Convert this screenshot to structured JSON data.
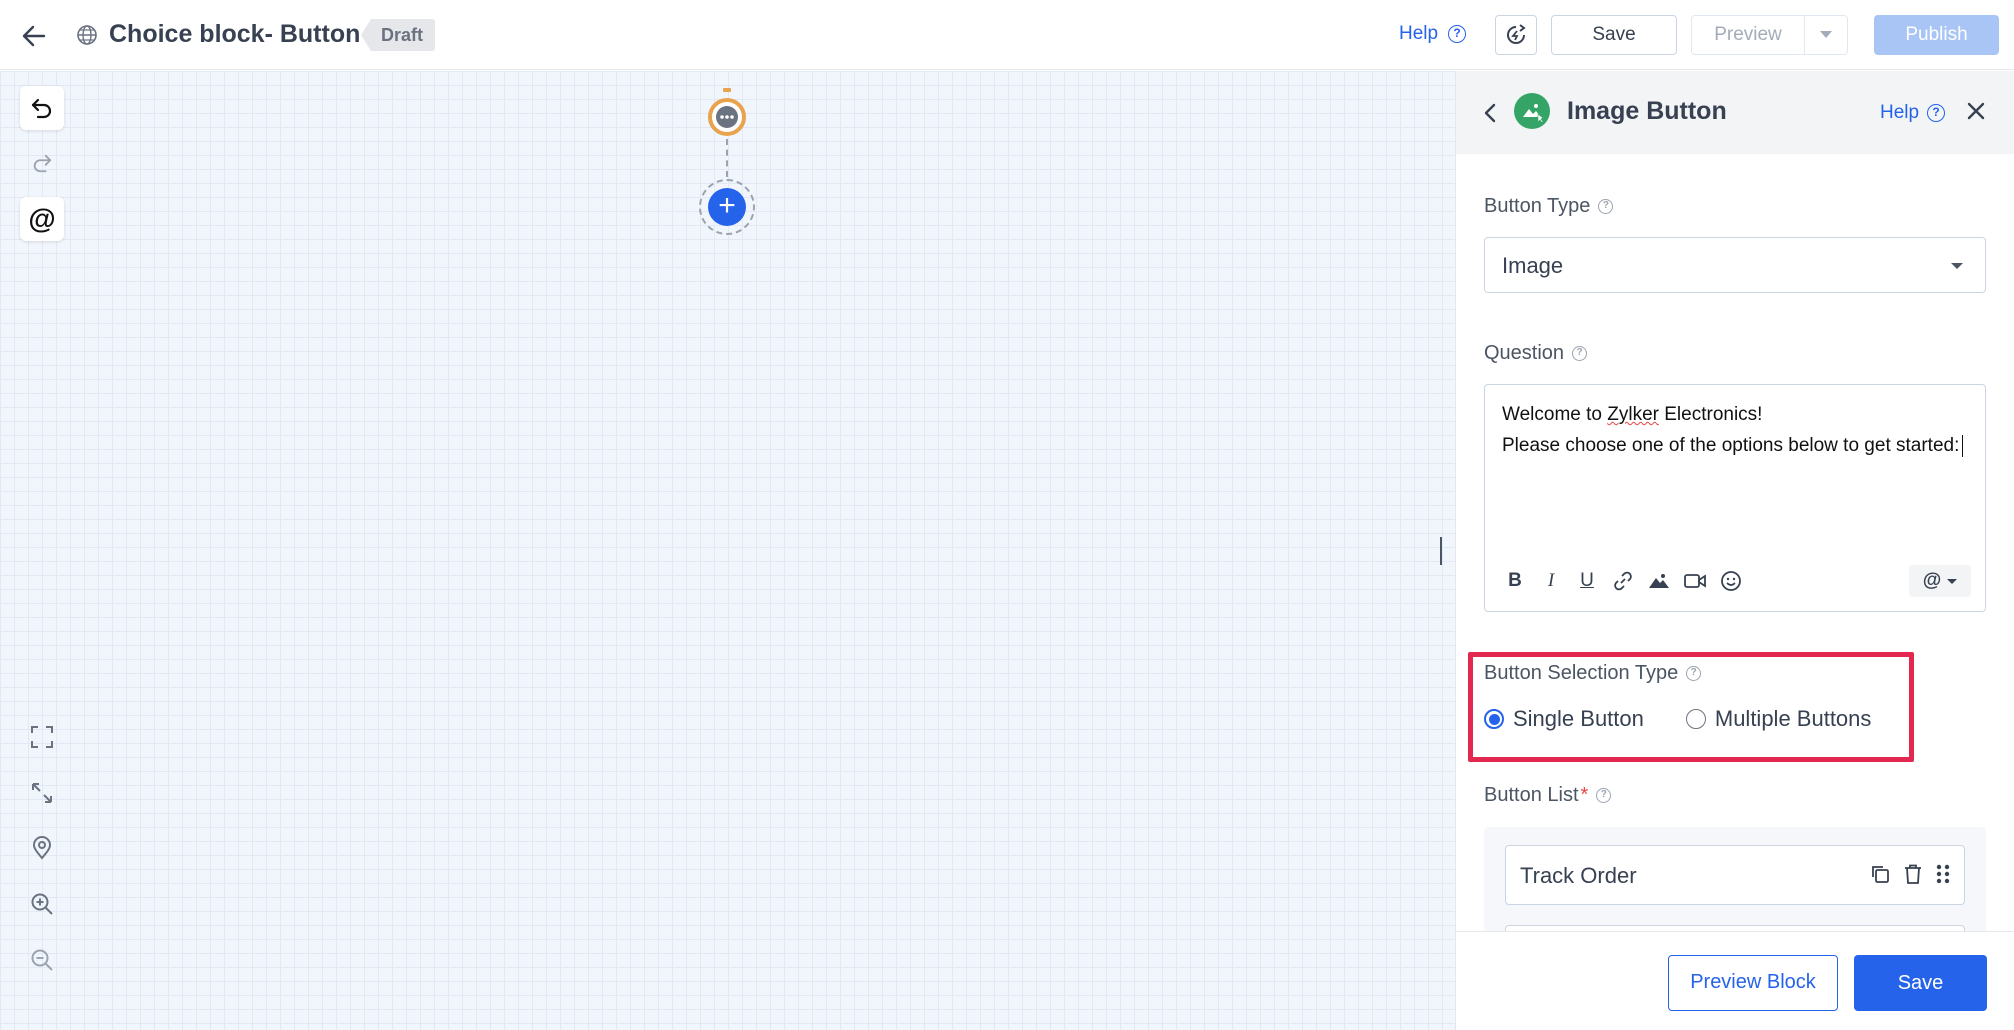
{
  "header": {
    "title": "Choice block- Button",
    "status_badge": "Draft",
    "help_label": "Help",
    "save_label": "Save",
    "preview_label": "Preview",
    "publish_label": "Publish"
  },
  "panel": {
    "title": "Image Button",
    "help_label": "Help",
    "button_type": {
      "label": "Button Type",
      "value": "Image"
    },
    "question": {
      "label": "Question",
      "line1_prefix": "Welcome to ",
      "line1_brand": "Zylker",
      "line1_suffix": " Electronics!",
      "line2": "Please choose one of the options below to get started:",
      "insert_label": "@"
    },
    "selection_type": {
      "label": "Button Selection Type",
      "options": [
        "Single Button",
        "Multiple Buttons"
      ],
      "selected": "Single Button"
    },
    "button_list": {
      "label": "Button List",
      "required_mark": "*",
      "items": [
        "Track Order"
      ]
    },
    "footer": {
      "preview_block_label": "Preview Block",
      "save_label": "Save"
    }
  },
  "canvas": {
    "at_label": "@",
    "add_label": "+"
  },
  "colors": {
    "primary": "#2563eb",
    "highlight": "#e3284f",
    "image_icon": "#34a567",
    "start_node": "#e8a34f"
  }
}
